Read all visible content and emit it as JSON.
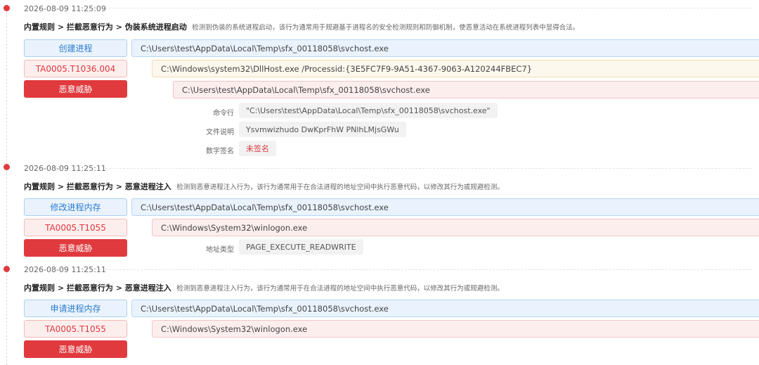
{
  "events": [
    {
      "time": "2026-08-09 11:25:09",
      "rule_path": "内置规则 > 拦截恶意行为 > 伪装系统进程启动",
      "rule_desc": "检测到伪装的系统进程启动，该行为通常用于规避基于进程名的安全检测规则和防御机制，使恶意活动在系统进程列表中显得合法。",
      "action": "创建进程",
      "technique": "TA0005.T1036.004",
      "verdict": "恶意威胁",
      "proc1": "C:\\Users\\test\\AppData\\Local\\Temp\\sfx_00118058\\svchost.exe",
      "proc2": "C:\\Windows\\system32\\DllHost.exe /Processid:{3E5FC7F9-9A51-4367-9063-A120244FBEC7}",
      "proc3": "C:\\Users\\test\\AppData\\Local\\Temp\\sfx_00118058\\svchost.exe",
      "attrs": [
        {
          "label": "命令行",
          "value": "\"C:\\Users\\test\\AppData\\Local\\Temp\\sfx_00118058\\svchost.exe\""
        },
        {
          "label": "文件说明",
          "value": "Ysvmwizhudo DwKprFhW PNlhLMjsGWu"
        },
        {
          "label": "数字签名",
          "value": "未签名"
        }
      ]
    },
    {
      "time": "2026-08-09 11:25:11",
      "rule_path": "内置规则 > 拦截恶意行为 > 恶意进程注入",
      "rule_desc": "检测到恶意进程注入行为，该行为通常用于在合法进程的地址空间中执行恶意代码，以修改其行为或规避检测。",
      "action": "修改进程内存",
      "technique": "TA0005.T1055",
      "verdict": "恶意威胁",
      "proc1": "C:\\Users\\test\\AppData\\Local\\Temp\\sfx_00118058\\svchost.exe",
      "proc2": "C:\\Windows\\System32\\winlogon.exe",
      "attrs": [
        {
          "label": "地址类型",
          "value": "PAGE_EXECUTE_READWRITE"
        }
      ]
    },
    {
      "time": "2026-08-09 11:25:11",
      "rule_path": "内置规则 > 拦截恶意行为 > 恶意进程注入",
      "rule_desc": "检测到恶意进程注入行为，该行为通常用于在合法进程的地址空间中执行恶意代码，以修改其行为或规避检测。",
      "action": "申请进程内存",
      "technique": "TA0005.T1055",
      "verdict": "恶意威胁",
      "proc1": "C:\\Users\\test\\AppData\\Local\\Temp\\sfx_00118058\\svchost.exe",
      "proc2": "C:\\Windows\\System32\\winlogon.exe"
    }
  ],
  "colors": {
    "dot": "#e0393e",
    "blue_text": "#2d7dd2",
    "red": "#e03a3e"
  }
}
